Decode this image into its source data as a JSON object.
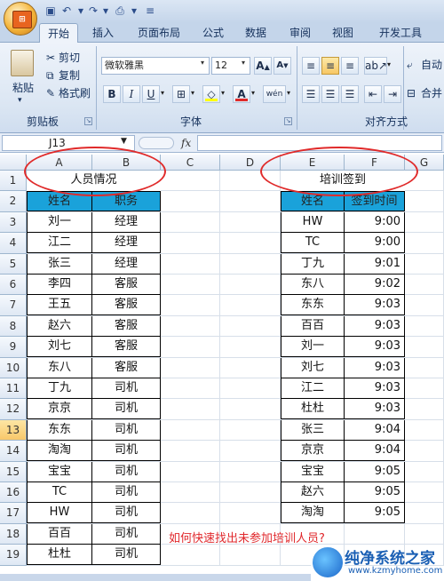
{
  "quick_access": {
    "icons": [
      "save-icon",
      "undo-icon",
      "redo-icon",
      "print-preview-icon",
      "customize-icon"
    ]
  },
  "tabs": [
    "开始",
    "插入",
    "页面布局",
    "公式",
    "数据",
    "审阅",
    "视图",
    "开发工具"
  ],
  "active_tab": "开始",
  "ribbon": {
    "clipboard": {
      "paste": "粘贴",
      "cut": "剪切",
      "copy": "复制",
      "format_painter": "格式刷",
      "label": "剪贴板"
    },
    "font": {
      "font_name": "微软雅黑",
      "font_size": "12",
      "bold": "B",
      "italic": "I",
      "underline": "U",
      "phonetic": "wén",
      "label": "字体",
      "font_color": "#e02a2a",
      "fill_color": "#ffff00"
    },
    "alignment": {
      "wrap": "自动",
      "merge": "合并",
      "label": "对齐方式"
    }
  },
  "formula_bar": {
    "name_box": "J13",
    "fx": "fx",
    "formula": ""
  },
  "columns": [
    "A",
    "B",
    "C",
    "D",
    "E",
    "F",
    "G"
  ],
  "rows": [
    "1",
    "2",
    "3",
    "4",
    "5",
    "6",
    "7",
    "8",
    "9",
    "10",
    "11",
    "12",
    "13",
    "14",
    "15",
    "16",
    "17",
    "18",
    "19"
  ],
  "selected_row": "13",
  "personnel": {
    "title": "人员情况",
    "headers": [
      "姓名",
      "职务"
    ],
    "rows": [
      [
        "刘一",
        "经理"
      ],
      [
        "江二",
        "经理"
      ],
      [
        "张三",
        "经理"
      ],
      [
        "李四",
        "客服"
      ],
      [
        "王五",
        "客服"
      ],
      [
        "赵六",
        "客服"
      ],
      [
        "刘七",
        "客服"
      ],
      [
        "东八",
        "客服"
      ],
      [
        "丁九",
        "司机"
      ],
      [
        "京京",
        "司机"
      ],
      [
        "东东",
        "司机"
      ],
      [
        "淘淘",
        "司机"
      ],
      [
        "宝宝",
        "司机"
      ],
      [
        "TC",
        "司机"
      ],
      [
        "HW",
        "司机"
      ],
      [
        "百百",
        "司机"
      ],
      [
        "杜杜",
        "司机"
      ]
    ]
  },
  "training": {
    "title": "培训签到",
    "headers": [
      "姓名",
      "签到时间"
    ],
    "rows": [
      [
        "HW",
        "9:00"
      ],
      [
        "TC",
        "9:00"
      ],
      [
        "丁九",
        "9:01"
      ],
      [
        "东八",
        "9:02"
      ],
      [
        "东东",
        "9:03"
      ],
      [
        "百百",
        "9:03"
      ],
      [
        "刘一",
        "9:03"
      ],
      [
        "刘七",
        "9:03"
      ],
      [
        "江二",
        "9:03"
      ],
      [
        "杜杜",
        "9:03"
      ],
      [
        "张三",
        "9:04"
      ],
      [
        "京京",
        "9:04"
      ],
      [
        "宝宝",
        "9:05"
      ],
      [
        "赵六",
        "9:05"
      ],
      [
        "淘淘",
        "9:05"
      ]
    ]
  },
  "note": "如何快速找出未参加培训人员?",
  "watermark": {
    "name": "纯净系统之家",
    "url": "www.kzmyhome.com"
  },
  "colors": {
    "header_fill": "#1aa2da",
    "ellipse": "#e02a2a",
    "ribbon_blue": "#c4d5ea"
  }
}
